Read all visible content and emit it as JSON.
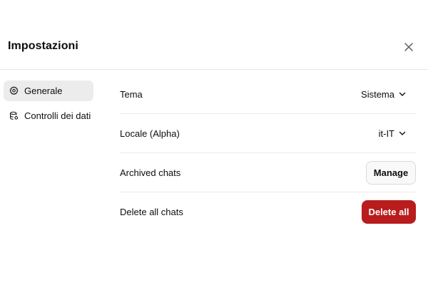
{
  "dialog": {
    "title": "Impostazioni",
    "close_icon": "close-icon"
  },
  "sidebar": {
    "items": [
      {
        "label": "Generale",
        "icon": "gear-icon",
        "active": true
      },
      {
        "label": "Controlli dei dati",
        "icon": "database-settings-icon",
        "active": false
      }
    ]
  },
  "settings": {
    "theme": {
      "label": "Tema",
      "value": "Sistema"
    },
    "locale": {
      "label": "Locale (Alpha)",
      "value": "it-IT"
    },
    "archived": {
      "label": "Archived chats",
      "button": "Manage"
    },
    "delete_all": {
      "label": "Delete all chats",
      "button": "Delete all"
    }
  },
  "colors": {
    "danger": "#b91c1c",
    "active_bg": "#ececec",
    "divider": "#e5e5e5"
  }
}
